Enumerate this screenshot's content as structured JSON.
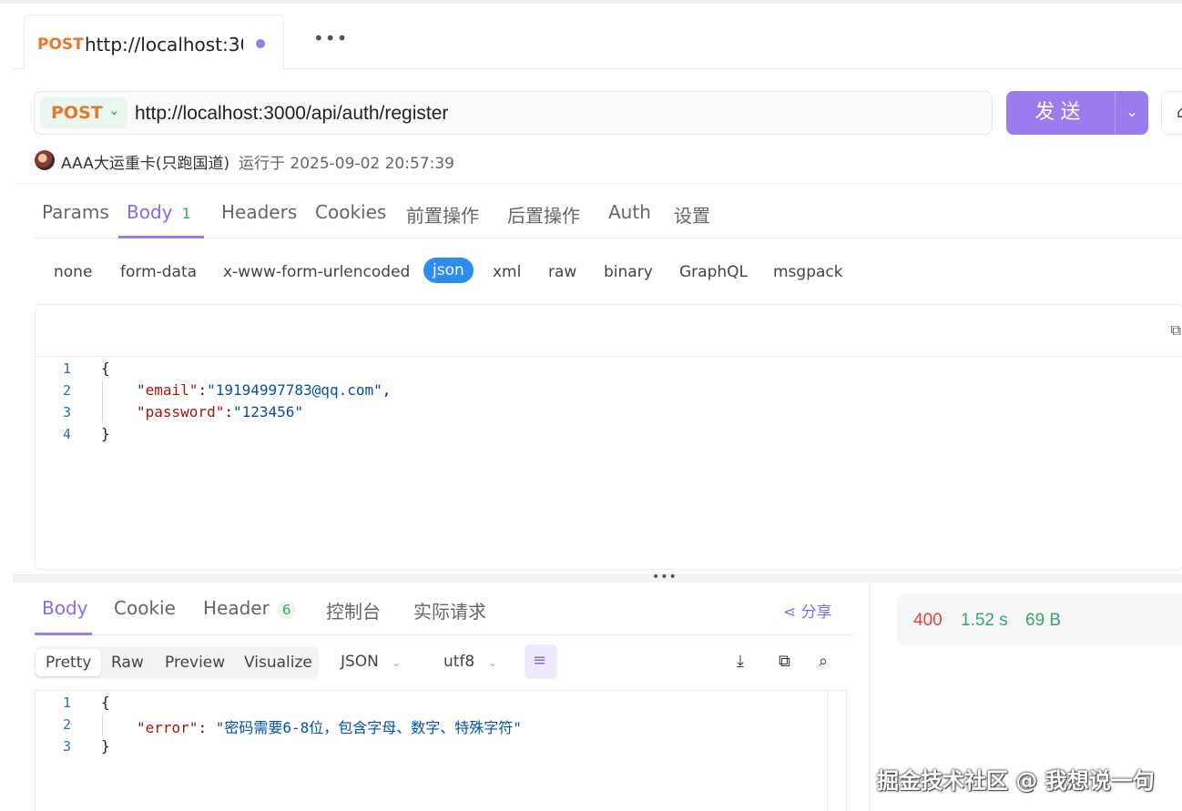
{
  "tab": {
    "method": "POST",
    "title": "http://localhost:30(",
    "more": "•••"
  },
  "request": {
    "method": "POST",
    "url": "http://localhost:3000/api/auth/register",
    "send_label": "发送",
    "run_user": "AAA大运重卡(只跑国道)",
    "run_info": "运行于 2025-09-02 20:57:39"
  },
  "request_tabs": [
    {
      "label": "Params"
    },
    {
      "label": "Body",
      "badge": "1"
    },
    {
      "label": "Headers"
    },
    {
      "label": "Cookies"
    },
    {
      "label": "前置操作"
    },
    {
      "label": "后置操作"
    },
    {
      "label": "Auth"
    },
    {
      "label": "设置"
    }
  ],
  "body_types": [
    "none",
    "form-data",
    "x-www-form-urlencoded",
    "json",
    "xml",
    "raw",
    "binary",
    "GraphQL",
    "msgpack"
  ],
  "body_type_selected": "json",
  "request_body": {
    "line_numbers": [
      "1",
      "2",
      "3",
      "4"
    ],
    "lines": [
      {
        "t": "{"
      },
      {
        "key": "\"email\"",
        "sep": ":",
        "val": "\"19194997783@qq.com\"",
        "end": ","
      },
      {
        "key": "\"password\"",
        "sep": ":",
        "val": "\"123456\"",
        "end": ""
      },
      {
        "t": "}"
      }
    ]
  },
  "response_tabs": [
    {
      "label": "Body"
    },
    {
      "label": "Cookie"
    },
    {
      "label": "Header",
      "badge": "6"
    },
    {
      "label": "控制台"
    },
    {
      "label": "实际请求"
    }
  ],
  "share_label": "分享",
  "view_modes": [
    "Pretty",
    "Raw",
    "Preview",
    "Visualize"
  ],
  "view_mode_selected": "Pretty",
  "format": "JSON",
  "encoding": "utf8",
  "response_body": {
    "line_numbers": [
      "1",
      "2",
      "3"
    ],
    "lines": [
      {
        "t": "{"
      },
      {
        "key": "\"error\"",
        "sep": ": ",
        "val": "\"密码需要6-8位，包含字母、数字、特殊字符\""
      },
      {
        "t": "}"
      }
    ]
  },
  "status": {
    "code": "400",
    "time": "1.52 s",
    "size": "69 B"
  },
  "watermark": "掘金技术社区 @ 我想说一句",
  "colors": {
    "accent": "#9b7cef",
    "method": "#e8772e",
    "success": "#35a86b",
    "error": "#e0443a",
    "selected_chip": "#2d8cf0"
  }
}
